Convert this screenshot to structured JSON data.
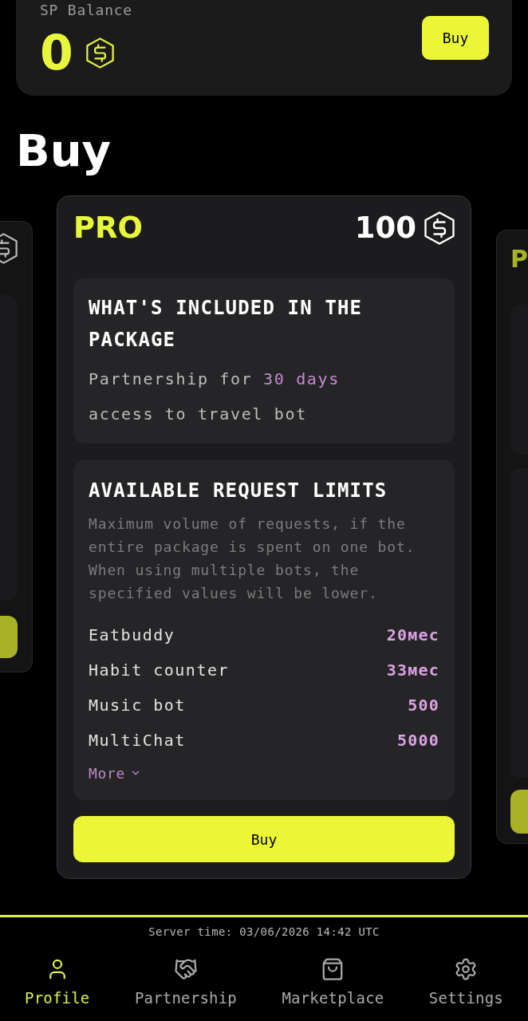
{
  "balance": {
    "label": "SP Balance",
    "value": "0",
    "button": "Buy"
  },
  "heading": "Buy",
  "packages": [
    {
      "kind": "peek",
      "selected": false
    },
    {
      "kind": "full",
      "selected": true,
      "title": "PRO",
      "price": "100",
      "included": {
        "heading": "WHAT'S INCLUDED IN THE PACKAGE",
        "items": [
          {
            "text": "Partnership for",
            "highlight": "30 days"
          },
          {
            "text": "access to travel bot"
          }
        ]
      },
      "limits": {
        "heading": "AVAILABLE REQUEST LIMITS",
        "note": "Maximum volume of requests, if the entire package is spent on one bot. When using multiple bots, the specified values will be lower.",
        "rows": [
          {
            "bot": "Eatbuddy",
            "limit": "20мес"
          },
          {
            "bot": "Habit counter",
            "limit": "33мес"
          },
          {
            "bot": "Music bot",
            "limit": "500"
          },
          {
            "bot": "MultiChat",
            "limit": "5000"
          }
        ],
        "more": "More",
        "expanded": false
      },
      "button": "Buy"
    },
    {
      "kind": "peek",
      "selected": false,
      "title": "P"
    }
  ],
  "server_time": "Server time: 03/06/2026 14:42 UTC",
  "nav": [
    {
      "label": "Profile",
      "selected": true
    },
    {
      "label": "Partnership",
      "selected": false
    },
    {
      "label": "Marketplace",
      "selected": false
    },
    {
      "label": "Settings",
      "selected": false
    }
  ]
}
